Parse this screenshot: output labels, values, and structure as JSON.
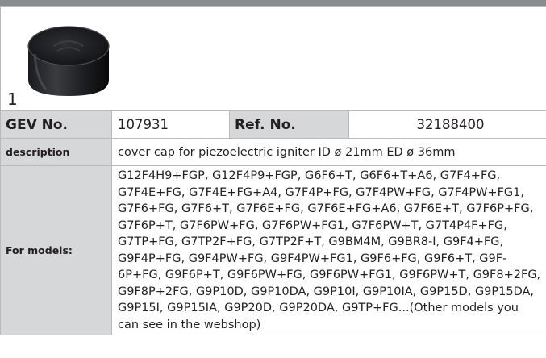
{
  "image": {
    "number": "1",
    "icon": "cover-cap-photo"
  },
  "row1": {
    "gev_label": "GEV No.",
    "gev_value": "107931",
    "ref_label": "Ref. No.",
    "ref_value": "32188400"
  },
  "description": {
    "label": "description",
    "value": "cover cap  for piezoelectric igniter ID ø 21mm ED ø 36mm"
  },
  "models": {
    "label": "For models:",
    "lines": [
      "G12F4H9+FGP, G12F4P9+FGP, G6F6+T, G6F6+T+A6, G7F4+FG,",
      "G7F4E+FG, G7F4E+FG+A4, G7F4P+FG, G7F4PW+FG, G7F4PW+FG1,",
      "G7F6+FG, G7F6+T, G7F6E+FG, G7F6E+FG+A6, G7F6E+T, G7F6P+FG,",
      "G7F6P+T, G7F6PW+FG, G7F6PW+FG1, G7F6PW+T, G7T4P4F+FG,",
      "G7TP+FG, G7TP2F+FG, G7TP2F+T, G9BM4M, G9BR8-I, G9F4+FG,",
      "G9F4P+FG, G9F4PW+FG, G9F4PW+FG1, G9F6+FG, G9F6+T, G9F-",
      "6P+FG, G9F6P+T, G9F6PW+FG, G9F6PW+FG1, G9F6PW+T, G9F8+2FG,",
      "G9F8P+2FG, G9P10D, G9P10DA, G9P10I, G9P10IA, G9P15D, G9P15DA,",
      "G9P15I, G9P15IA, G9P20D, G9P20DA, G9TP+FG...(Other models you",
      "can see in the webshop)"
    ]
  },
  "colors": {
    "top_bar": "#8a8b8d",
    "label_bg": "#d6d7d8",
    "border": "#b9b9b9",
    "text": "#231f20"
  }
}
